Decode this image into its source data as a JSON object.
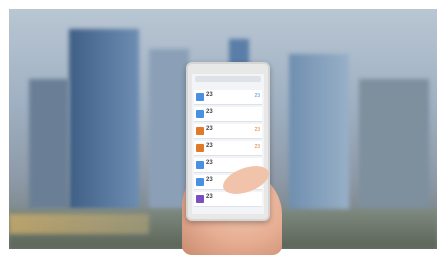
{
  "scene": {
    "description_colors": {
      "sky": "#b9c6d3",
      "buildings": "#5f7fa6",
      "ground": "#6f7b74",
      "phone_frame": "#e8e8e8",
      "hand": "#e6ad92"
    }
  },
  "phone": {
    "app_title": "",
    "rows": [
      {
        "icon_color": "#4a90e2",
        "temp": "23",
        "temp2": "23"
      },
      {
        "icon_color": "#4a90e2",
        "temp": "23",
        "temp2": ""
      },
      {
        "icon_color": "#e07a2b",
        "temp": "23",
        "temp2": "23"
      },
      {
        "icon_color": "#e07a2b",
        "temp": "23",
        "temp2": "23"
      },
      {
        "icon_color": "#4a90e2",
        "temp": "23",
        "temp2": ""
      },
      {
        "icon_color": "#4a90e2",
        "temp": "23",
        "temp2": ""
      },
      {
        "icon_color": "#7b4fbf",
        "temp": "23",
        "temp2": ""
      }
    ]
  }
}
